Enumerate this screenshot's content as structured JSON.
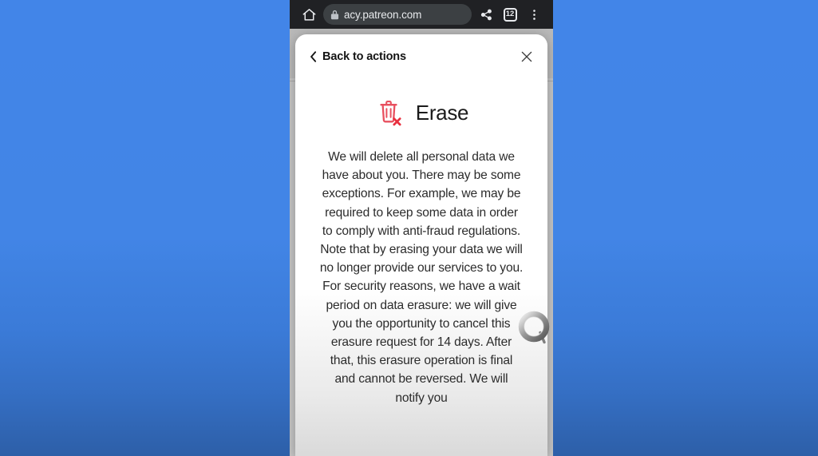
{
  "browser": {
    "home_icon": "home-icon",
    "lock_icon": "lock-icon",
    "url": "acy.patreon.com",
    "url_placeholder": "Search or type web address",
    "share_icon": "share-icon",
    "tab_count": "12",
    "menu_icon": "overflow-menu-icon"
  },
  "modal": {
    "back_label": "Back to actions",
    "back_chevron_icon": "chevron-left-icon",
    "close_icon": "close-icon",
    "title": "Erase",
    "title_icon": "trash-delete-icon",
    "body": "We will delete all personal data we have about you. There may be some exceptions. For example, we may be required to keep some data in order to comply with anti-fraud regulations. Note that by erasing your data we will no longer provide our services to you. For security reasons, we have a wait period on data erasure: we will give you the opportunity to cancel this erasure request for 14 days. After that, this erasure operation is final and cannot be reversed. We will notify you"
  },
  "pointer": {
    "icon": "touch-pointer-ring"
  },
  "colors": {
    "wallpaper_top": "#4285e8",
    "wallpaper_bottom": "#2d5fa8",
    "browser_bar": "#202124",
    "omnibox": "#3c4043",
    "modal_bg": "#ffffff",
    "trash_red": "#e8505f",
    "page_bg": "#c5c5c5"
  }
}
